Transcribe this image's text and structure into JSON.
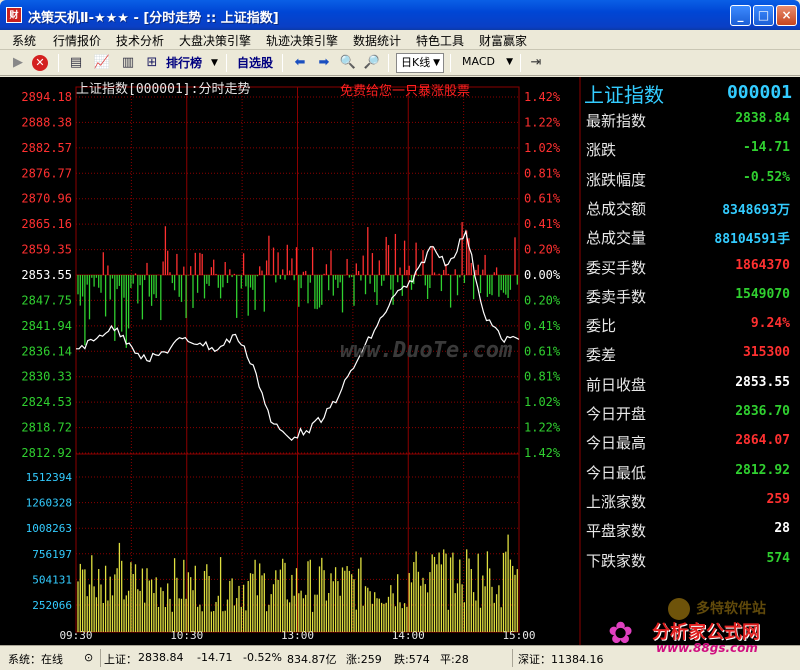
{
  "window": {
    "title": "决策天机Ⅱ-★★★ - [分时走势 :: 上证指数]",
    "app_icon": "财"
  },
  "menu": [
    "系统",
    "行情报价",
    "技术分析",
    "大盘决策引擎",
    "轨迹决策引擎",
    "数据统计",
    "特色工具",
    "财富赢家"
  ],
  "toolbar": {
    "rank": "排行榜",
    "watchlist": "自选股",
    "period": "日K线",
    "indicator": "MACD"
  },
  "chart": {
    "header": "上证指数[000001]:分时走势",
    "banner": "免费给您一只暴涨股票",
    "watermark": "www.DuoTe.com",
    "left_ticks": [
      "2894.18",
      "2888.38",
      "2882.57",
      "2876.77",
      "2870.96",
      "2865.16",
      "2859.35",
      "2853.55",
      "2847.75",
      "2841.94",
      "2836.14",
      "2830.33",
      "2824.53",
      "2818.72",
      "2812.92"
    ],
    "right_ticks": [
      "1.42%",
      "1.22%",
      "1.02%",
      "0.81%",
      "0.61%",
      "0.41%",
      "0.20%",
      "0.00%",
      "0.20%",
      "0.41%",
      "0.61%",
      "0.81%",
      "1.02%",
      "1.22%",
      "1.42%"
    ],
    "volume_ticks": [
      "1512394",
      "1260328",
      "1008263",
      "756197",
      "504131",
      "252066"
    ],
    "time_ticks": [
      "09:30",
      "10:30",
      "13:00",
      "14:00",
      "15:00"
    ],
    "colors": {
      "up": "#ff3030",
      "down": "#30d030",
      "flat": "#ffffff",
      "volume": "#e0e040",
      "line": "#ffffff",
      "grid": "#8b0000"
    }
  },
  "info": {
    "name": "上证指数",
    "code": "000001",
    "rows": [
      {
        "label": "最新指数",
        "value": "2838.84",
        "color": "#30d030"
      },
      {
        "label": "涨跌",
        "value": "-14.71",
        "color": "#30d030"
      },
      {
        "label": "涨跌幅度",
        "value": "-0.52%",
        "color": "#30d030"
      },
      {
        "label": "总成交额",
        "value": "8348693万",
        "color": "#33ccff"
      },
      {
        "label": "总成交量",
        "value": "88104591手",
        "color": "#33ccff"
      },
      {
        "label": "委买手数",
        "value": "1864370",
        "color": "#ff3030"
      },
      {
        "label": "委卖手数",
        "value": "1549070",
        "color": "#30d030"
      },
      {
        "label": "委比",
        "value": "9.24%",
        "color": "#ff3030"
      },
      {
        "label": "委差",
        "value": "315300",
        "color": "#ff3030"
      },
      {
        "label": "前日收盘",
        "value": "2853.55",
        "color": "#ffffff"
      },
      {
        "label": "今日开盘",
        "value": "2836.70",
        "color": "#30d030"
      },
      {
        "label": "今日最高",
        "value": "2864.07",
        "color": "#ff3030"
      },
      {
        "label": "今日最低",
        "value": "2812.92",
        "color": "#30d030"
      },
      {
        "label": "上涨家数",
        "value": "259",
        "color": "#ff3030"
      },
      {
        "label": "平盘家数",
        "value": "28",
        "color": "#ffffff"
      },
      {
        "label": "下跌家数",
        "value": "574",
        "color": "#30d030"
      }
    ]
  },
  "status": {
    "system": "系统：在线",
    "sh_label": "上证：",
    "sh_price": "2838.84",
    "sh_change": "-14.71",
    "sh_pct": "-0.52%",
    "sh_amount": "834.87亿",
    "up": "涨:259",
    "down": "跌:574",
    "flat": "平:28",
    "sz": "深证：11384.16"
  },
  "watermark_site": {
    "top": "多特软件站",
    "main": "分析家公式网",
    "url": "www.88gs.com"
  },
  "chart_data": {
    "type": "line",
    "y_range": [
      2812.92,
      2894.18
    ],
    "prev_close": 2853.55,
    "series": [
      {
        "x": [
          "09:30",
          "09:40",
          "09:50",
          "10:00",
          "10:10",
          "10:20",
          "10:30",
          "10:40",
          "10:50",
          "11:00",
          "11:10",
          "11:20",
          "11:30",
          "13:00",
          "13:10",
          "13:20",
          "13:30",
          "13:40",
          "13:50",
          "14:00",
          "14:10",
          "14:20",
          "14:30",
          "14:40",
          "14:50",
          "15:00"
        ],
        "values": [
          2836.7,
          2838.5,
          2841.9,
          2838.0,
          2834.0,
          2836.0,
          2839.0,
          2838.0,
          2836.5,
          2840.0,
          2833.0,
          2820.0,
          2816.5,
          2818.0,
          2821.0,
          2827.5,
          2835.0,
          2842.0,
          2849.0,
          2852.0,
          2860.0,
          2856.0,
          2863.5,
          2845.0,
          2839.0,
          2838.84
        ]
      }
    ]
  }
}
